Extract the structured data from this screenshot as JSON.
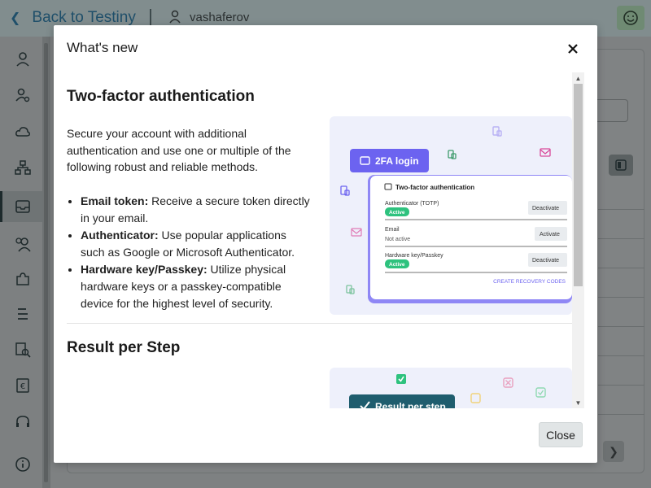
{
  "app": {
    "back_link": "Back to Testiny",
    "username": "vashaferov"
  },
  "sidebar": {
    "items": [
      {
        "icon": "user-icon"
      },
      {
        "icon": "user-settings-icon"
      },
      {
        "icon": "cloud-icon"
      },
      {
        "icon": "hierarchy-icon"
      },
      {
        "icon": "inbox-icon",
        "active": true
      },
      {
        "icon": "users-icon"
      },
      {
        "icon": "puzzle-icon"
      },
      {
        "icon": "list-icon"
      },
      {
        "icon": "search-document-icon"
      },
      {
        "icon": "currency-icon"
      },
      {
        "icon": "headset-icon"
      },
      {
        "icon": "info-icon"
      }
    ]
  },
  "modal": {
    "title": "What's new",
    "close_label": "Close",
    "sections": [
      {
        "title": "Two-factor authentication",
        "description": "Secure your account with additional authentication and use one or multiple of the following robust and reliable methods.",
        "features": [
          {
            "term": "Email token:",
            "text": " Receive a secure token directly in your email."
          },
          {
            "term": "Authenticator:",
            "text": " Use popular applications such as Google or Microsoft Authenticator."
          },
          {
            "term": "Hardware key/Passkey:",
            "text": " Utilize physical hardware keys or a passkey-compatible device for the highest level of security."
          }
        ],
        "illustration": {
          "badge": "2FA login",
          "card_title": "Two-factor authentication",
          "rows": [
            {
              "name": "Authenticator (TOTP)",
              "status": "Active",
              "action": "Deactivate"
            },
            {
              "name": "Email",
              "status": "Not active",
              "action": "Activate"
            },
            {
              "name": "Hardware key/Passkey",
              "status": "Active",
              "action": "Deactivate"
            }
          ],
          "link": "CREATE RECOVERY CODES"
        }
      },
      {
        "title": "Result per Step",
        "illustration": {
          "badge": "Result per step"
        }
      }
    ]
  },
  "colors": {
    "accent": "#6c63f0",
    "active_green": "#2ec27e",
    "overlay": "#7f8384"
  }
}
